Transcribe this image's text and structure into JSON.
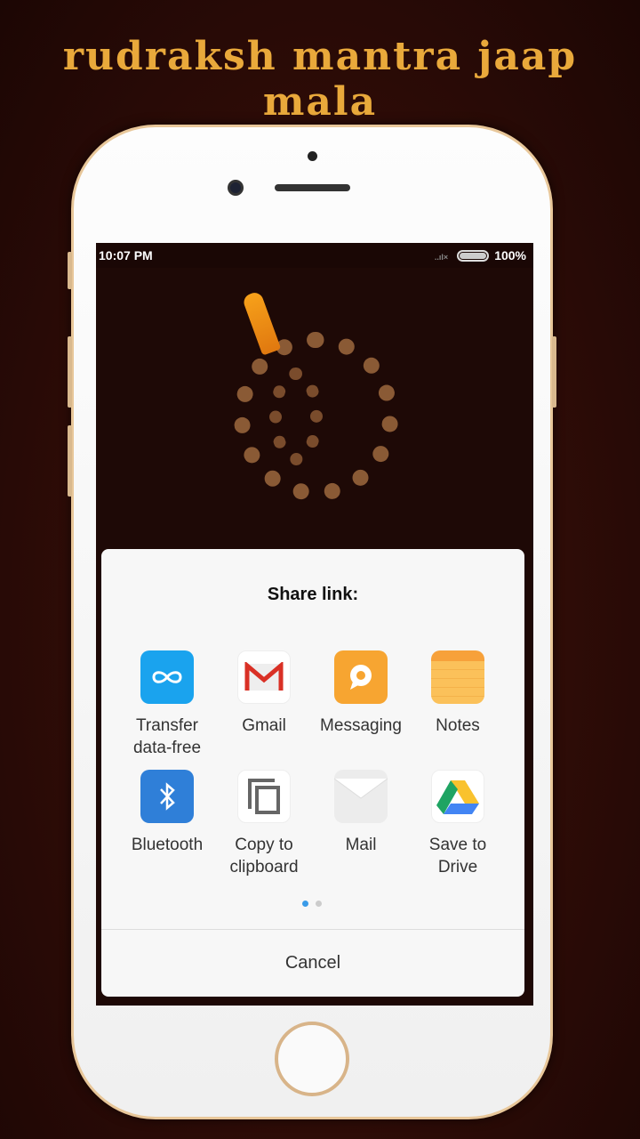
{
  "banner": {
    "title": "rudraksh mantra jaap mala"
  },
  "status_bar": {
    "time": "10:07 PM",
    "battery": "100%"
  },
  "share_dialog": {
    "title": "Share link:",
    "apps": [
      {
        "label": "Transfer data-free",
        "icon": "infinity-icon",
        "color": "#1aa3ee"
      },
      {
        "label": "Gmail",
        "icon": "gmail-icon",
        "color": "#d93025"
      },
      {
        "label": "Messaging",
        "icon": "message-bubble-icon",
        "color": "#f7a531"
      },
      {
        "label": "Notes",
        "icon": "notes-icon",
        "color": "#fbc15a"
      },
      {
        "label": "Bluetooth",
        "icon": "bluetooth-icon",
        "color": "#2f7fd8"
      },
      {
        "label": "Copy to clipboard",
        "icon": "copy-icon",
        "color": "#666666"
      },
      {
        "label": "Mail",
        "icon": "envelope-icon",
        "color": "#e8e8e8"
      },
      {
        "label": "Save to Drive",
        "icon": "google-drive-icon",
        "color": "#1fa463"
      }
    ],
    "page_indicator": {
      "current": 1,
      "total": 2
    },
    "cancel_label": "Cancel"
  }
}
